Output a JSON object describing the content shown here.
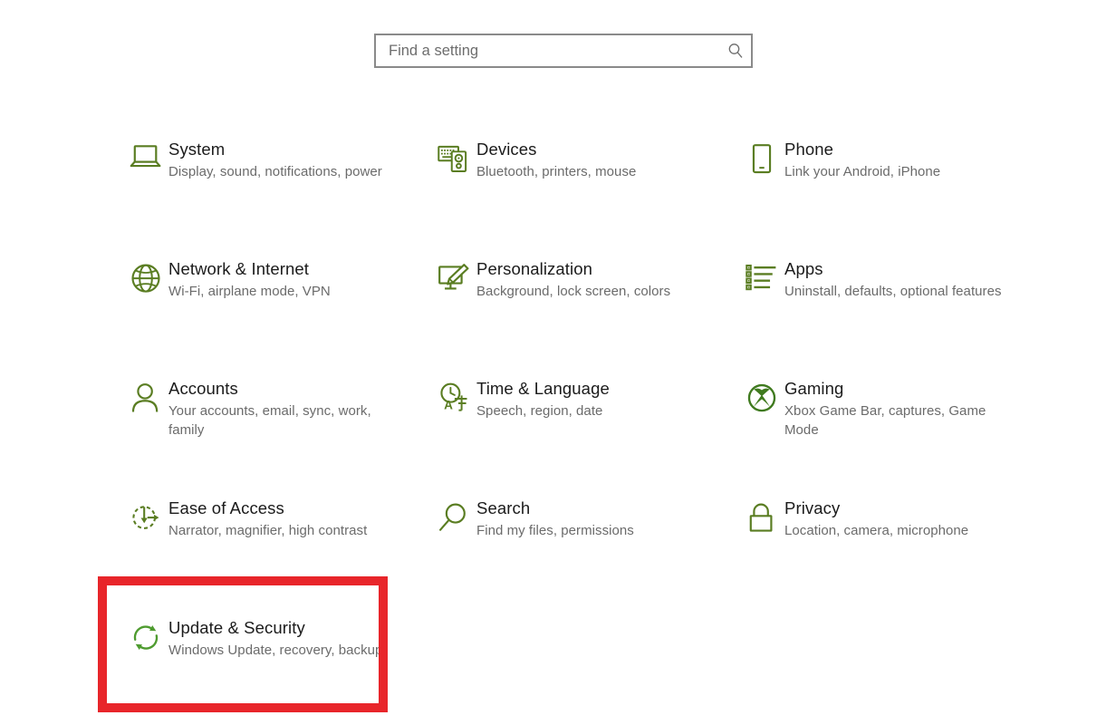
{
  "search": {
    "placeholder": "Find a setting",
    "value": "",
    "icon": "search-icon"
  },
  "theme": {
    "icon_green": "#5a7d22",
    "title_color": "#1b1b1b",
    "subtitle_color": "#6b6b6b",
    "highlight_red": "#e8252a"
  },
  "settings": {
    "items": [
      {
        "title": "System",
        "subtitle": "Display, sound, notifications, power",
        "icon": "laptop-icon",
        "highlighted": false
      },
      {
        "title": "Devices",
        "subtitle": "Bluetooth, printers, mouse",
        "icon": "keyboard-mouse-icon",
        "highlighted": false
      },
      {
        "title": "Phone",
        "subtitle": "Link your Android, iPhone",
        "icon": "smartphone-icon",
        "highlighted": false
      },
      {
        "title": "Network & Internet",
        "subtitle": "Wi-Fi, airplane mode, VPN",
        "icon": "globe-icon",
        "highlighted": false
      },
      {
        "title": "Personalization",
        "subtitle": "Background, lock screen, colors",
        "icon": "monitor-paintbrush-icon",
        "highlighted": false
      },
      {
        "title": "Apps",
        "subtitle": "Uninstall, defaults, optional features",
        "icon": "list-icon",
        "highlighted": false
      },
      {
        "title": "Accounts",
        "subtitle": "Your accounts, email, sync, work, family",
        "icon": "person-icon",
        "highlighted": false
      },
      {
        "title": "Time & Language",
        "subtitle": "Speech, region, date",
        "icon": "clock-language-icon",
        "highlighted": false
      },
      {
        "title": "Gaming",
        "subtitle": "Xbox Game Bar, captures, Game Mode",
        "icon": "xbox-icon",
        "highlighted": false
      },
      {
        "title": "Ease of Access",
        "subtitle": "Narrator, magnifier, high contrast",
        "icon": "ease-of-access-icon",
        "highlighted": false
      },
      {
        "title": "Search",
        "subtitle": "Find my files, permissions",
        "icon": "magnifier-icon",
        "highlighted": false
      },
      {
        "title": "Privacy",
        "subtitle": "Location, camera, microphone",
        "icon": "lock-icon",
        "highlighted": false
      },
      {
        "title": "Update & Security",
        "subtitle": "Windows Update, recovery, backup",
        "icon": "refresh-circle-icon",
        "highlighted": true
      }
    ]
  }
}
